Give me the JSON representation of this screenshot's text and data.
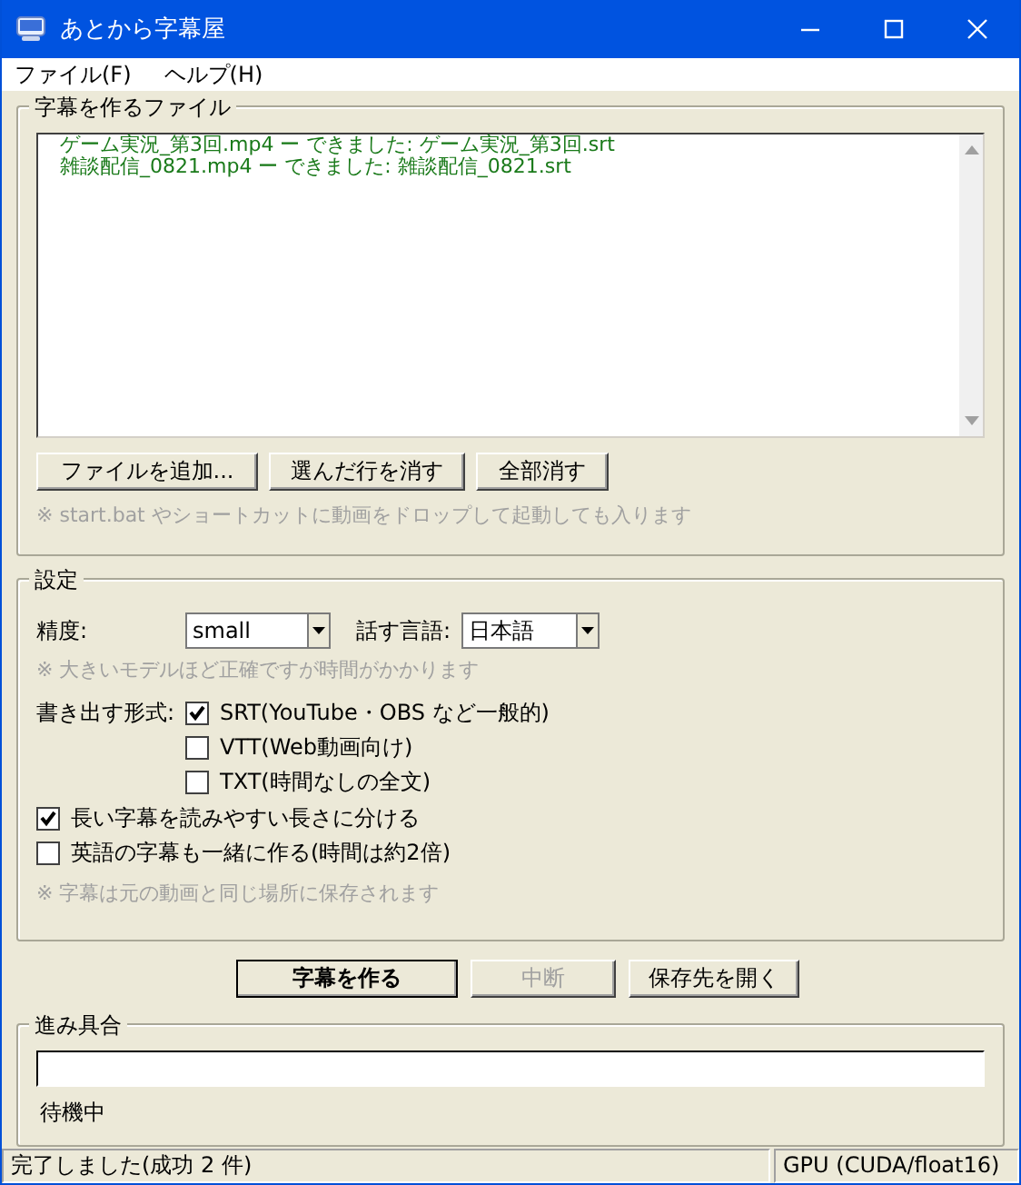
{
  "window": {
    "title": "あとから字幕屋"
  },
  "menu": [
    "ファイル(F)",
    "ヘルプ(H)"
  ],
  "files": {
    "title": "字幕を作るファイル",
    "items": [
      "ゲーム実況_第3回.mp4  ー できました: ゲーム実況_第3回.srt",
      "雑談配信_0821.mp4  ー できました: 雑談配信_0821.srt"
    ],
    "buttons": [
      "ファイルを追加...",
      "選んだ行を消す",
      "全部消す"
    ],
    "note": "※ start.bat やショートカットに動画をドロップして起動しても入ります"
  },
  "settings": {
    "title": "設定",
    "accuracy": {
      "label": "精度:",
      "value": "small"
    },
    "language": {
      "label": "話す言語:",
      "value": "日本語"
    },
    "model_note": "※ 大きいモデルほど正確ですが時間がかかります",
    "format_label": "書き出す形式:",
    "formats": [
      {
        "label": "SRT(YouTube・OBS など一般的)",
        "checked": true
      },
      {
        "label": "VTT(Web動画向け)",
        "checked": false
      },
      {
        "label": "TXT(時間なしの全文)",
        "checked": false
      }
    ],
    "options": [
      {
        "label": "長い字幕を読みやすい長さに分ける",
        "checked": true
      },
      {
        "label": "英語の字幕も一緒に作る(時間は約2倍)",
        "checked": false
      }
    ],
    "save_note": "※ 字幕は元の動画と同じ場所に保存されます"
  },
  "actions": [
    {
      "label": "字幕を作る",
      "primary": true,
      "disabled": false
    },
    {
      "label": "中断",
      "primary": false,
      "disabled": true
    },
    {
      "label": "保存先を開く",
      "primary": false,
      "disabled": false
    }
  ],
  "progress": {
    "title": "進み具合",
    "level": 0,
    "status": "待機中"
  },
  "status_bar": [
    "完了しました(成功 2 件)",
    "GPU (CUDA/float16)"
  ]
}
